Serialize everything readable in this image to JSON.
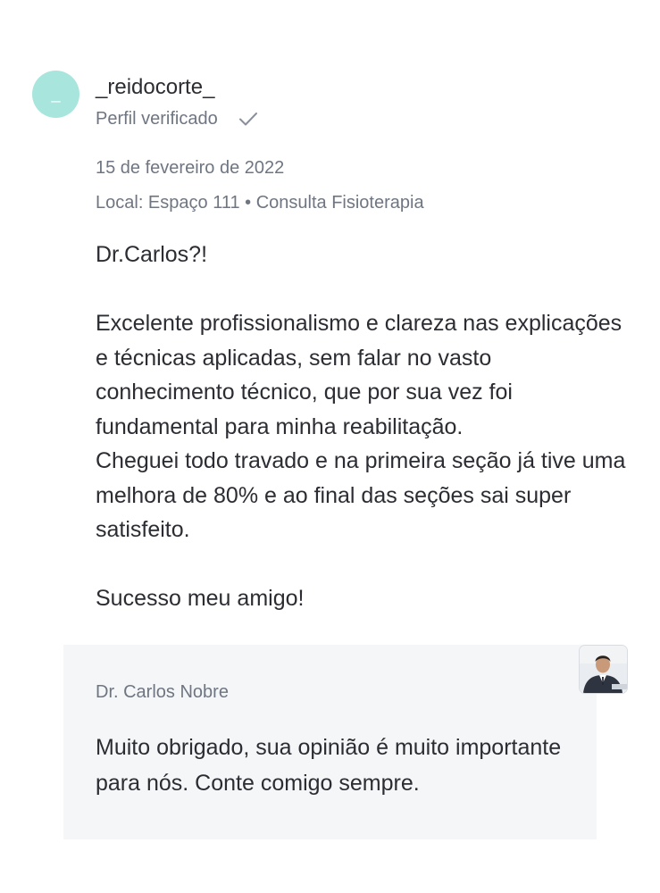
{
  "reviewer": {
    "avatar_initial": "_",
    "username": "_reidocorte_",
    "verified_label": "Perfil verificado",
    "verified_icon": "check-icon"
  },
  "review": {
    "date": "15 de fevereiro de 2022",
    "location": "Local: Espaço 111 • Consulta Fisioterapia",
    "greeting": "Dr.Carlos?!",
    "paragraph_1": "Excelente profissionalismo e clareza nas explicações e técnicas aplicadas, sem falar no vasto conhecimento técnico, que por sua vez foi fundamental para minha reabilitação.",
    "paragraph_2": "Cheguei todo travado e na primeira seção já tive uma melhora de 80% e ao final das seções sai super satisfeito.",
    "closing": "Sucesso meu amigo!"
  },
  "reply": {
    "author": "Dr. Carlos Nobre",
    "text": "Muito obrigado, sua opinião é muito importante para nós. Conte comigo sempre."
  },
  "colors": {
    "avatar_bg": "#a8e6dd",
    "muted_text": "#6f7682",
    "body_text": "#2b2d33",
    "reply_bg": "#f4f6f8"
  }
}
